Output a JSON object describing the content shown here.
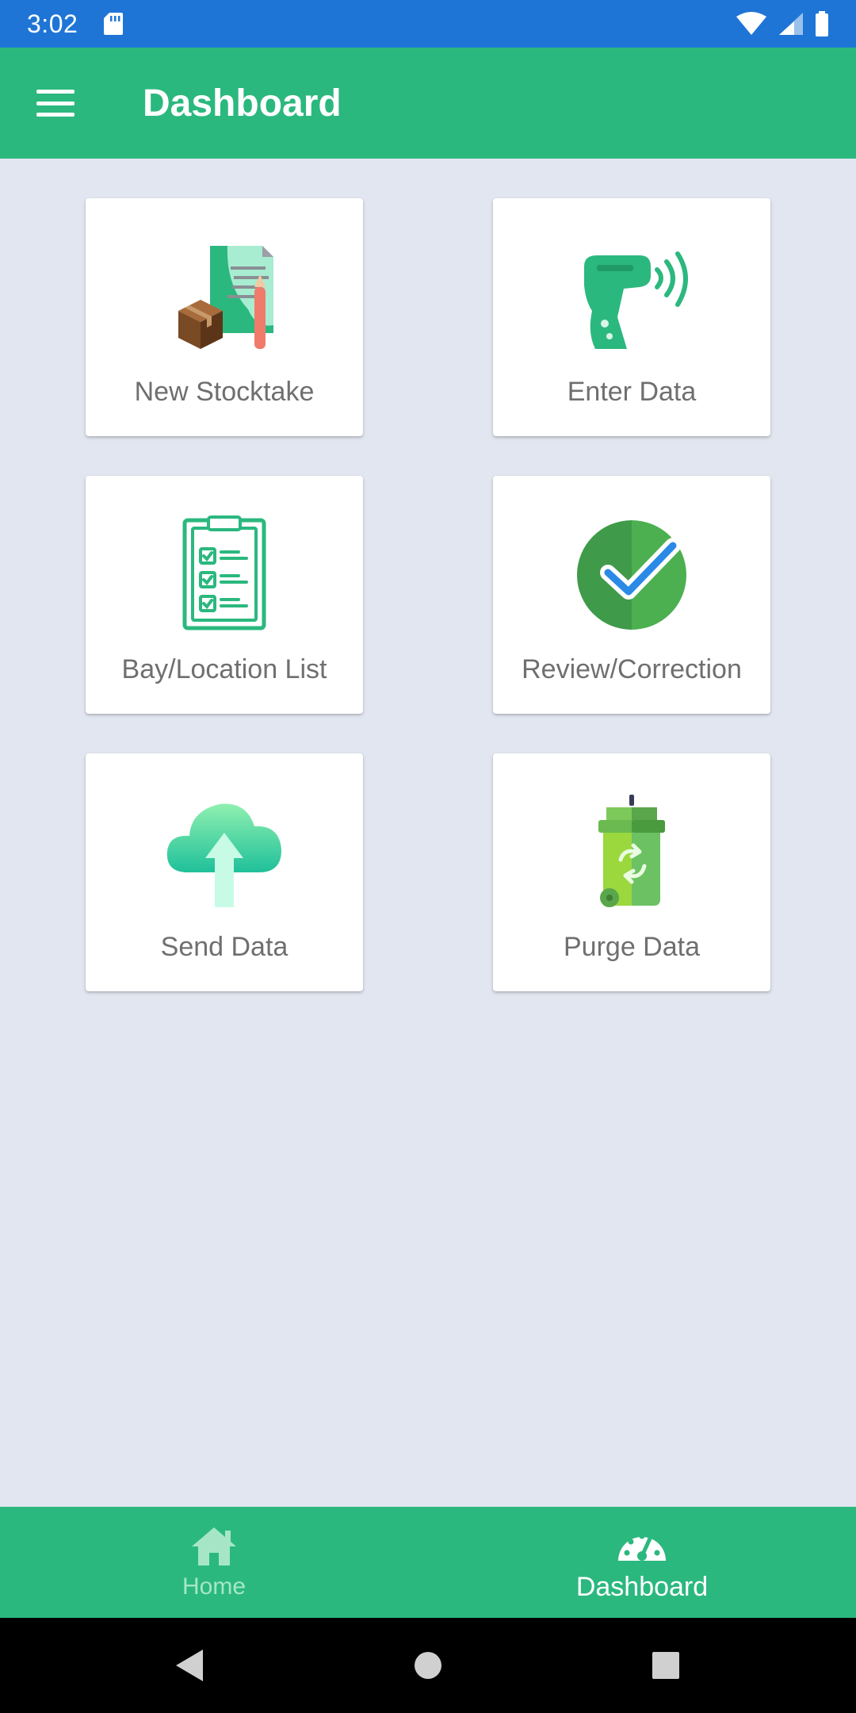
{
  "status_bar": {
    "time": "3:02",
    "icons": [
      "sd-card-icon",
      "wifi-icon",
      "signal-icon",
      "battery-icon"
    ]
  },
  "app_bar": {
    "title": "Dashboard",
    "menu_icon": "hamburger-menu-icon"
  },
  "tiles": [
    {
      "label": "New Stocktake",
      "icon": "stocktake-document-box-icon"
    },
    {
      "label": "Enter Data",
      "icon": "barcode-scanner-icon"
    },
    {
      "label": "Bay/Location List",
      "icon": "clipboard-checklist-icon"
    },
    {
      "label": "Review/Correction",
      "icon": "checkmark-circle-icon"
    },
    {
      "label": "Send Data",
      "icon": "cloud-upload-icon"
    },
    {
      "label": "Purge Data",
      "icon": "recycle-bin-icon"
    }
  ],
  "bottom_nav": {
    "items": [
      {
        "label": "Home",
        "icon": "home-icon",
        "active": false
      },
      {
        "label": "Dashboard",
        "icon": "speedometer-icon",
        "active": true
      }
    ]
  },
  "system_nav": [
    "back-icon",
    "home-circle-icon",
    "recents-square-icon"
  ],
  "colors": {
    "status_bar": "#1f75d6",
    "primary": "#2bb87e",
    "background": "#e1e6f0",
    "tile_label": "#6f6f6f"
  }
}
